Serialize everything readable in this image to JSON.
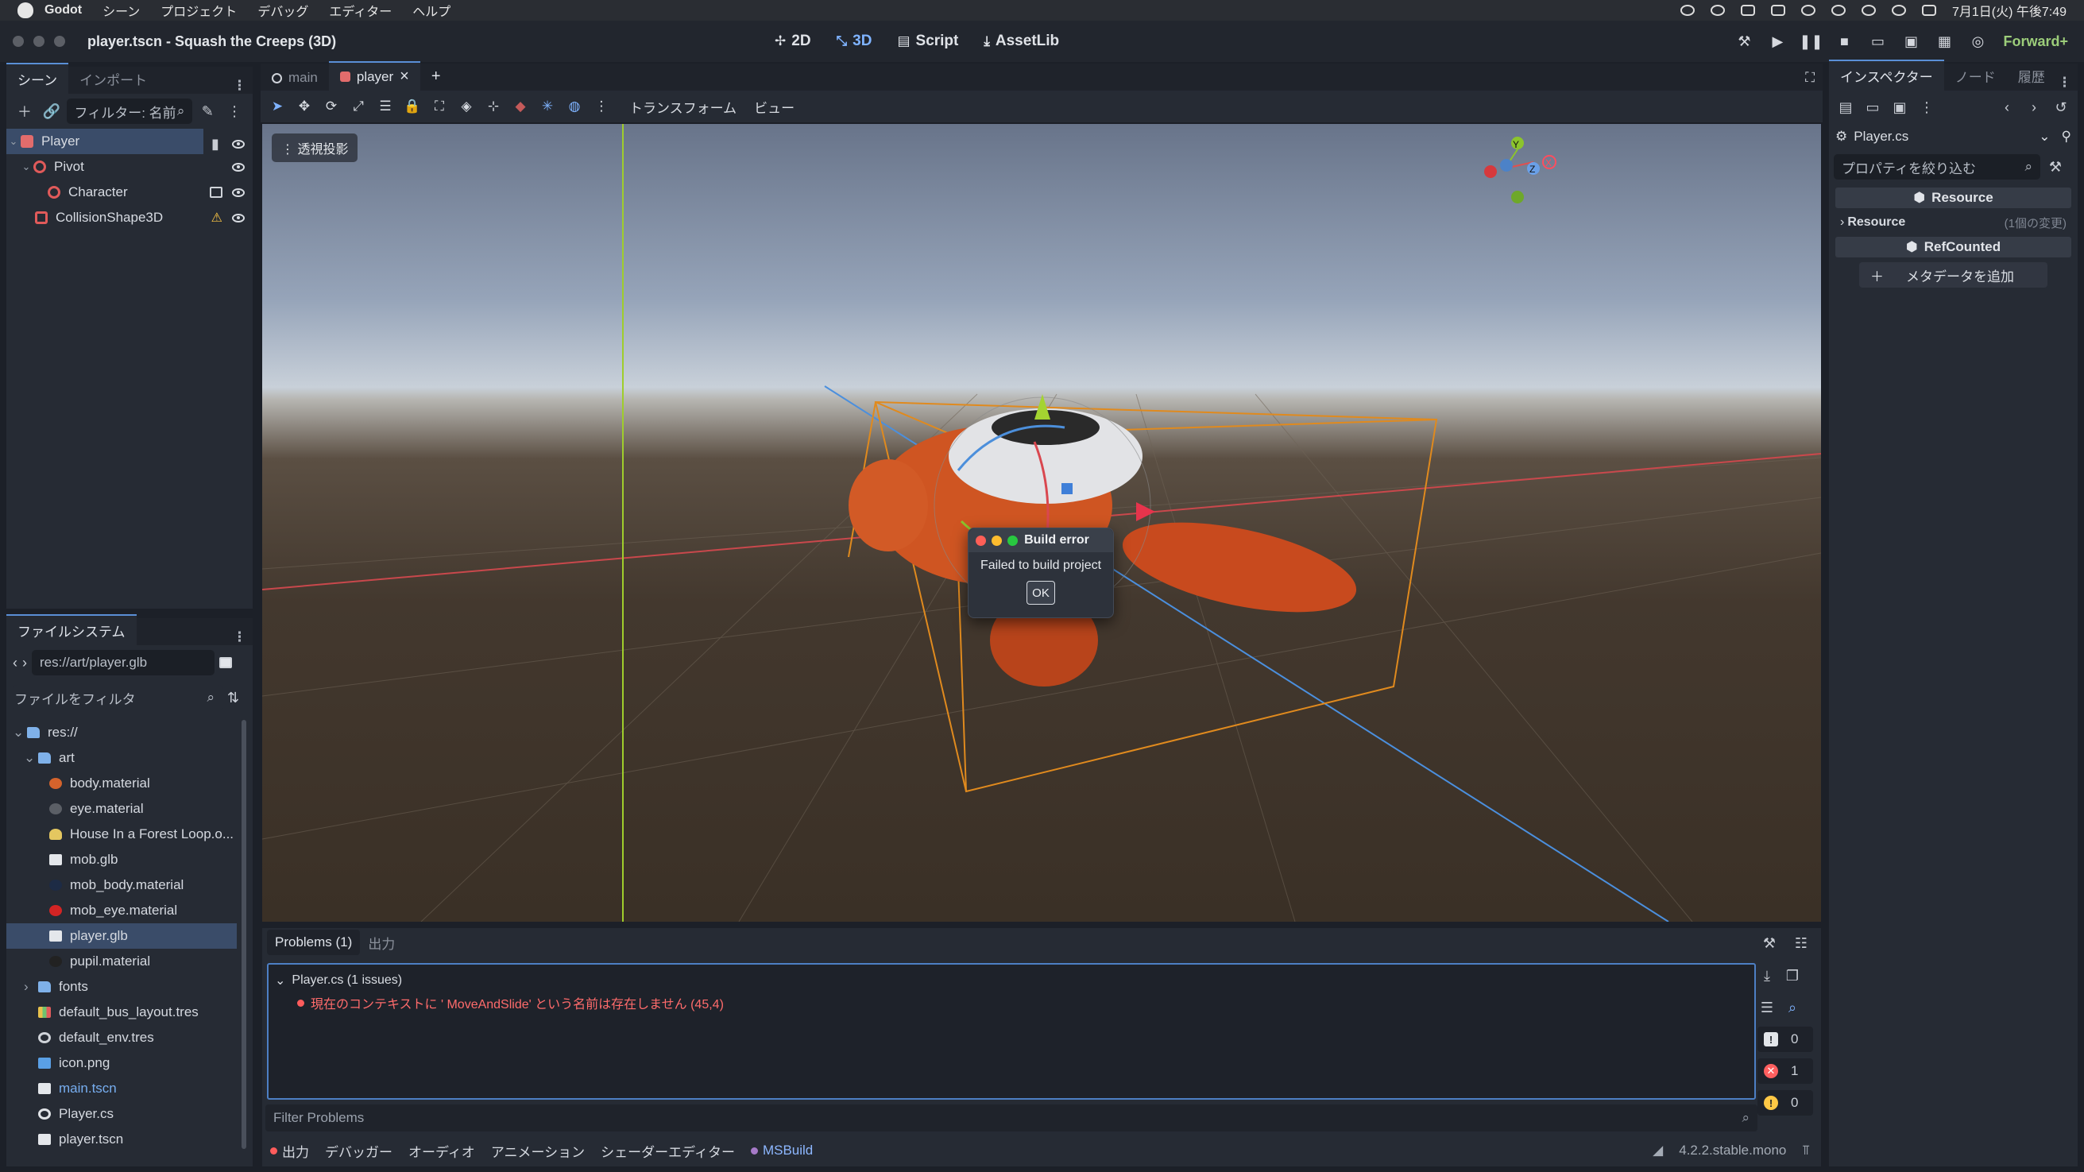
{
  "menubar": {
    "app": "Godot",
    "items": [
      "シーン",
      "プロジェクト",
      "デバッグ",
      "エディター",
      "ヘルプ"
    ],
    "datetime": "7月1日(火) 午後7:49"
  },
  "window": {
    "title": "player.tscn - Squash the Creeps (3D)"
  },
  "modes": {
    "two_d": "2D",
    "three_d": "3D",
    "script": "Script",
    "assetlib": "AssetLib"
  },
  "renderer": "Forward+",
  "scene_dock": {
    "tabs": [
      "シーン",
      "インポート"
    ],
    "filter_placeholder": "フィルター: 名前",
    "nodes": [
      {
        "name": "Player"
      },
      {
        "name": "Pivot"
      },
      {
        "name": "Character"
      },
      {
        "name": "CollisionShape3D"
      }
    ]
  },
  "fs_dock": {
    "title": "ファイルシステム",
    "path": "res://art/player.glb",
    "filter_placeholder": "ファイルをフィルタ",
    "items": [
      {
        "label": "res://",
        "icon": "folder"
      },
      {
        "label": "art",
        "icon": "folder"
      },
      {
        "label": "body.material",
        "icon": "material"
      },
      {
        "label": "eye.material",
        "icon": "material"
      },
      {
        "label": "House In a Forest Loop.o...",
        "icon": "music"
      },
      {
        "label": "mob.glb",
        "icon": "scene"
      },
      {
        "label": "mob_body.material",
        "icon": "material"
      },
      {
        "label": "mob_eye.material",
        "icon": "material"
      },
      {
        "label": "player.glb",
        "icon": "scene"
      },
      {
        "label": "pupil.material",
        "icon": "material"
      },
      {
        "label": "fonts",
        "icon": "folder"
      },
      {
        "label": "default_bus_layout.tres",
        "icon": "bus"
      },
      {
        "label": "default_env.tres",
        "icon": "globe"
      },
      {
        "label": "icon.png",
        "icon": "image"
      },
      {
        "label": "main.tscn",
        "icon": "scene"
      },
      {
        "label": "Player.cs",
        "icon": "gear"
      },
      {
        "label": "player.tscn",
        "icon": "scene"
      }
    ]
  },
  "doc_tabs": [
    "main",
    "player"
  ],
  "viewport": {
    "menus": [
      "トランスフォーム",
      "ビュー"
    ],
    "perspective": "透視投影",
    "gizmo_axes": [
      "Y",
      "Z",
      "X"
    ]
  },
  "dialog": {
    "title": "Build error",
    "message": "Failed to build project",
    "ok": "OK"
  },
  "problems": {
    "tabs": [
      "Problems (1)",
      "出力"
    ],
    "file": "Player.cs (1 issues)",
    "error": "現在のコンテキストに ' MoveAndSlide' という名前は存在しません (45,4)",
    "counts": {
      "info": "0",
      "errors": "1",
      "warnings": "0"
    },
    "filter_placeholder": "Filter Problems"
  },
  "status_bar": {
    "tabs": [
      "出力",
      "デバッガー",
      "オーディオ",
      "アニメーション",
      "シェーダーエディター",
      "MSBuild"
    ],
    "version": "4.2.2.stable.mono"
  },
  "inspector": {
    "tabs": [
      "インスペクター",
      "ノード",
      "履歴"
    ],
    "resource": "Player.cs",
    "filter_placeholder": "プロパティを絞り込む",
    "section_resource": "Resource",
    "prop_label": "Resource",
    "prop_value": "(1個の変更)",
    "section_refcounted": "RefCounted",
    "add_meta": "メタデータを追加"
  },
  "colors": {
    "accent": "#5a8fd6",
    "error": "#ff6b6b",
    "warning": "#ffc845"
  }
}
